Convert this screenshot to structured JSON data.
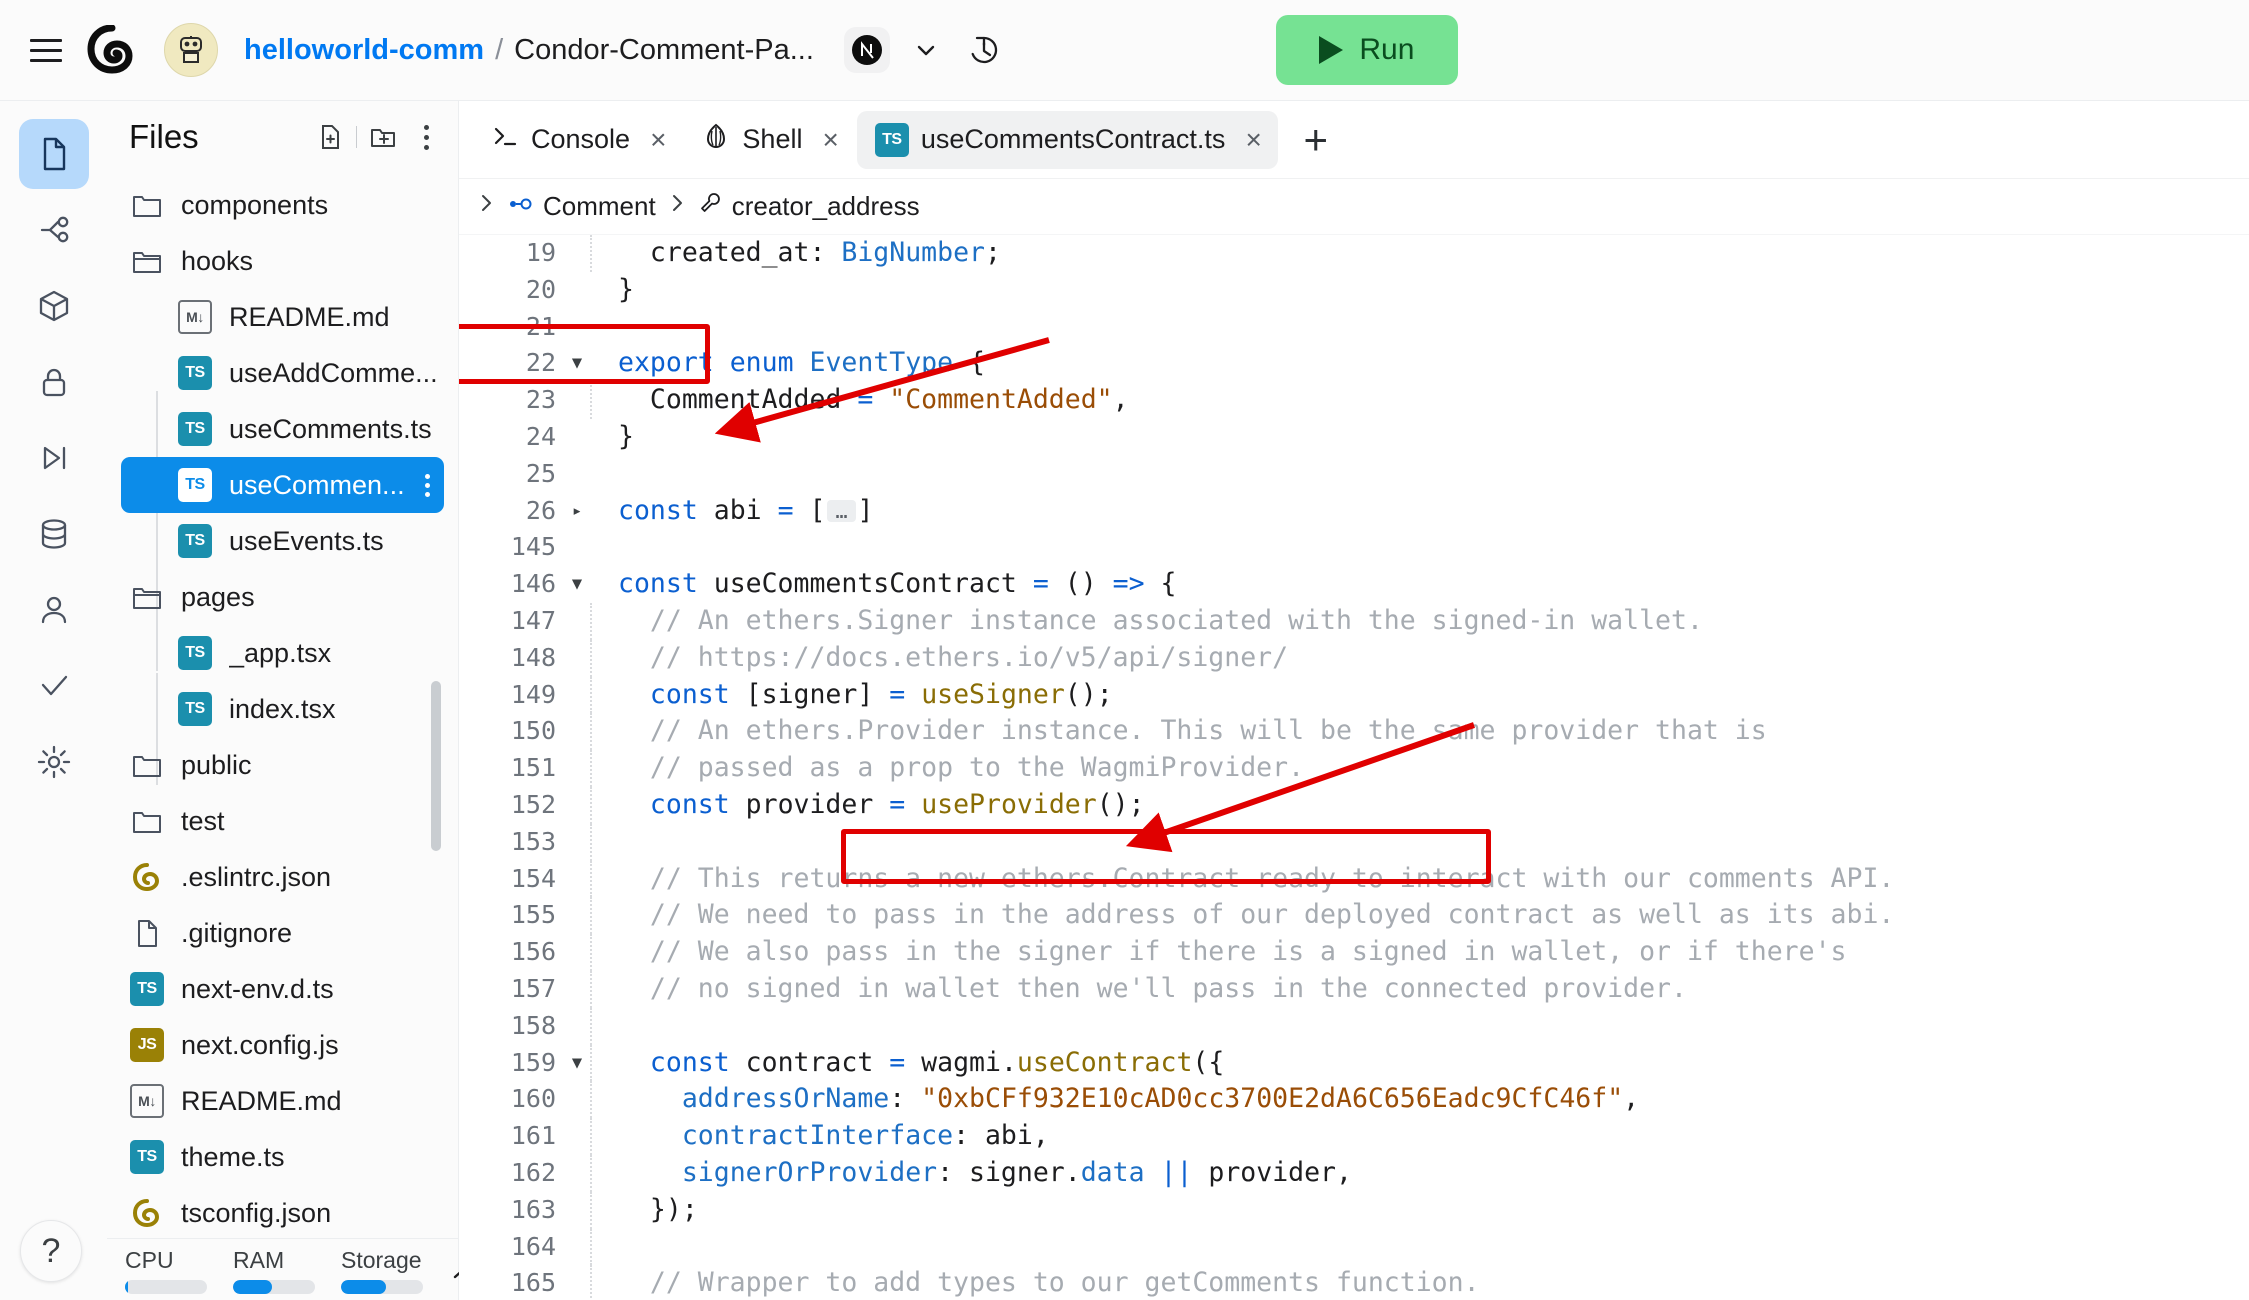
{
  "header": {
    "menu_icon": "hamburger-icon",
    "logo_icon": "replit-logo-icon",
    "avatar_icon": "robot-avatar-icon",
    "owner": "helloworld-comm",
    "separator": "/",
    "repl_name": "Condor-Comment-Pa...",
    "framework_badge": "nextjs-icon",
    "chevron_icon": "chevron-down-icon",
    "history_icon": "history-clock-icon",
    "run_label": "Run",
    "run_color": "#76e293"
  },
  "rail": {
    "items": [
      {
        "name": "files-icon",
        "active": true
      },
      {
        "name": "version-control-icon",
        "active": false
      },
      {
        "name": "packages-icon",
        "active": false
      },
      {
        "name": "secrets-lock-icon",
        "active": false
      },
      {
        "name": "deployments-icon",
        "active": false
      },
      {
        "name": "database-icon",
        "active": false
      },
      {
        "name": "authentication-user-icon",
        "active": false
      },
      {
        "name": "checks-icon",
        "active": false
      },
      {
        "name": "settings-gear-icon",
        "active": false
      }
    ],
    "help_label": "?"
  },
  "files": {
    "title": "Files",
    "new_file_icon": "new-file-icon",
    "new_folder_icon": "new-folder-icon",
    "more_icon": "more-vertical-icon",
    "tree": [
      {
        "label": "components",
        "type": "folder",
        "depth": 1,
        "open": false
      },
      {
        "label": "hooks",
        "type": "folder-open",
        "depth": 1,
        "open": true
      },
      {
        "label": "README.md",
        "type": "md",
        "depth": 2
      },
      {
        "label": "useAddComme...",
        "type": "ts",
        "depth": 2
      },
      {
        "label": "useComments.ts",
        "type": "ts",
        "depth": 2
      },
      {
        "label": "useCommen...",
        "type": "ts",
        "depth": 2,
        "selected": true
      },
      {
        "label": "useEvents.ts",
        "type": "ts",
        "depth": 2
      },
      {
        "label": "pages",
        "type": "folder-open",
        "depth": 1,
        "open": true
      },
      {
        "label": "_app.tsx",
        "type": "ts",
        "depth": 2
      },
      {
        "label": "index.tsx",
        "type": "ts",
        "depth": 2
      },
      {
        "label": "public",
        "type": "folder",
        "depth": 1
      },
      {
        "label": "test",
        "type": "folder",
        "depth": 1
      },
      {
        "label": ".eslintrc.json",
        "type": "replit",
        "depth": 1
      },
      {
        "label": ".gitignore",
        "type": "file",
        "depth": 1
      },
      {
        "label": "next-env.d.ts",
        "type": "ts",
        "depth": 1
      },
      {
        "label": "next.config.js",
        "type": "js",
        "depth": 1
      },
      {
        "label": "README.md",
        "type": "md",
        "depth": 1
      },
      {
        "label": "theme.ts",
        "type": "ts",
        "depth": 1
      },
      {
        "label": "tsconfig.json",
        "type": "replit",
        "depth": 1
      }
    ],
    "resources": [
      {
        "label": "CPU",
        "percent": 4
      },
      {
        "label": "RAM",
        "percent": 48
      },
      {
        "label": "Storage",
        "percent": 55
      }
    ],
    "collapse_icon": "chevron-up-icon"
  },
  "editor": {
    "tabs": [
      {
        "label": "Console",
        "icon": "console-prompt-icon",
        "active": false,
        "close": "×"
      },
      {
        "label": "Shell",
        "icon": "shell-icon",
        "active": false,
        "close": "×"
      },
      {
        "label": "useCommentsContract.ts",
        "icon": "ts-file-icon",
        "active": true,
        "close": "×"
      }
    ],
    "add_tab_label": "+",
    "breadcrumb": {
      "expand_icon": "chevron-right-icon",
      "items": [
        {
          "label": "Comment",
          "icon": "interface-icon"
        },
        {
          "label": "creator_address",
          "icon": "property-wrench-icon"
        }
      ],
      "separator": "›"
    },
    "code_lines": [
      {
        "no": "19",
        "fold": "",
        "indent": true,
        "tokens": [
          {
            "t": "  ",
            "c": "plain"
          },
          {
            "t": "created_at",
            "c": "plain"
          },
          {
            "t": ": ",
            "c": "plain"
          },
          {
            "t": "BigNumber",
            "c": "prop"
          },
          {
            "t": ";",
            "c": "plain"
          }
        ]
      },
      {
        "no": "20",
        "fold": "",
        "indent": false,
        "tokens": [
          {
            "t": "}",
            "c": "plain"
          }
        ]
      },
      {
        "no": "21",
        "fold": "",
        "indent": false,
        "tokens": []
      },
      {
        "no": "22",
        "fold": "▼",
        "indent": false,
        "tokens": [
          {
            "t": "export",
            "c": "kw"
          },
          {
            "t": " ",
            "c": "plain"
          },
          {
            "t": "enum",
            "c": "kw"
          },
          {
            "t": " ",
            "c": "plain"
          },
          {
            "t": "EventType",
            "c": "prop"
          },
          {
            "t": " {",
            "c": "plain"
          }
        ]
      },
      {
        "no": "23",
        "fold": "",
        "indent": true,
        "tokens": [
          {
            "t": "  CommentAdded ",
            "c": "plain"
          },
          {
            "t": "=",
            "c": "kw"
          },
          {
            "t": " ",
            "c": "plain"
          },
          {
            "t": "\"CommentAdded\"",
            "c": "str"
          },
          {
            "t": ",",
            "c": "plain"
          }
        ]
      },
      {
        "no": "24",
        "fold": "",
        "indent": false,
        "tokens": [
          {
            "t": "}",
            "c": "plain"
          }
        ]
      },
      {
        "no": "25",
        "fold": "",
        "indent": false,
        "tokens": []
      },
      {
        "no": "26",
        "fold": "▸",
        "indent": false,
        "highlighted": true,
        "tokens": [
          {
            "t": "const",
            "c": "kw"
          },
          {
            "t": " abi ",
            "c": "plain"
          },
          {
            "t": "=",
            "c": "kw"
          },
          {
            "t": " [",
            "c": "plain"
          },
          {
            "t": "…",
            "c": "ellip"
          },
          {
            "t": "]",
            "c": "plain"
          }
        ]
      },
      {
        "no": "145",
        "fold": "",
        "indent": false,
        "tokens": []
      },
      {
        "no": "146",
        "fold": "▼",
        "indent": false,
        "tokens": [
          {
            "t": "const",
            "c": "kw"
          },
          {
            "t": " useCommentsContract ",
            "c": "plain"
          },
          {
            "t": "=",
            "c": "kw"
          },
          {
            "t": " () ",
            "c": "plain"
          },
          {
            "t": "=>",
            "c": "kw"
          },
          {
            "t": " {",
            "c": "plain"
          }
        ]
      },
      {
        "no": "147",
        "fold": "",
        "indent": true,
        "tokens": [
          {
            "t": "  // An ethers.Signer instance associated with the signed-in wallet.",
            "c": "cmt"
          }
        ]
      },
      {
        "no": "148",
        "fold": "",
        "indent": true,
        "tokens": [
          {
            "t": "  // https://docs.ethers.io/v5/api/signer/",
            "c": "cmt"
          }
        ]
      },
      {
        "no": "149",
        "fold": "",
        "indent": true,
        "tokens": [
          {
            "t": "  ",
            "c": "plain"
          },
          {
            "t": "const",
            "c": "kw"
          },
          {
            "t": " [signer] ",
            "c": "plain"
          },
          {
            "t": "=",
            "c": "kw"
          },
          {
            "t": " ",
            "c": "plain"
          },
          {
            "t": "useSigner",
            "c": "fn"
          },
          {
            "t": "();",
            "c": "plain"
          }
        ]
      },
      {
        "no": "150",
        "fold": "",
        "indent": true,
        "tokens": [
          {
            "t": "  // An ethers.Provider instance. This will be the same provider that is",
            "c": "cmt"
          }
        ]
      },
      {
        "no": "151",
        "fold": "",
        "indent": true,
        "tokens": [
          {
            "t": "  // passed as a prop to the WagmiProvider.",
            "c": "cmt"
          }
        ]
      },
      {
        "no": "152",
        "fold": "",
        "indent": true,
        "tokens": [
          {
            "t": "  ",
            "c": "plain"
          },
          {
            "t": "const",
            "c": "kw"
          },
          {
            "t": " provider ",
            "c": "plain"
          },
          {
            "t": "=",
            "c": "kw"
          },
          {
            "t": " ",
            "c": "plain"
          },
          {
            "t": "useProvider",
            "c": "fn"
          },
          {
            "t": "();",
            "c": "plain"
          }
        ]
      },
      {
        "no": "153",
        "fold": "",
        "indent": true,
        "tokens": []
      },
      {
        "no": "154",
        "fold": "",
        "indent": true,
        "tokens": [
          {
            "t": "  // This returns a new ethers.Contract ready to interact with our comments API.",
            "c": "cmt"
          }
        ]
      },
      {
        "no": "155",
        "fold": "",
        "indent": true,
        "tokens": [
          {
            "t": "  // We need to pass in the address of our deployed contract as well as its abi.",
            "c": "cmt"
          }
        ]
      },
      {
        "no": "156",
        "fold": "",
        "indent": true,
        "tokens": [
          {
            "t": "  // We also pass in the signer if there is a signed in wallet, or if there's",
            "c": "cmt"
          }
        ]
      },
      {
        "no": "157",
        "fold": "",
        "indent": true,
        "tokens": [
          {
            "t": "  // no signed in wallet then we'll pass in the connected provider.",
            "c": "cmt"
          }
        ]
      },
      {
        "no": "158",
        "fold": "",
        "indent": true,
        "tokens": []
      },
      {
        "no": "159",
        "fold": "▼",
        "indent": true,
        "tokens": [
          {
            "t": "  ",
            "c": "plain"
          },
          {
            "t": "const",
            "c": "kw"
          },
          {
            "t": " contract ",
            "c": "plain"
          },
          {
            "t": "=",
            "c": "kw"
          },
          {
            "t": " wagmi.",
            "c": "plain"
          },
          {
            "t": "useContract",
            "c": "fn"
          },
          {
            "t": "({",
            "c": "plain"
          }
        ]
      },
      {
        "no": "160",
        "fold": "",
        "indent": true,
        "tokens": [
          {
            "t": "    ",
            "c": "plain"
          },
          {
            "t": "addressOrName",
            "c": "prop"
          },
          {
            "t": ": ",
            "c": "plain"
          },
          {
            "t": "\"0xbCFf932E10cAD0cc3700E2dA6C656Eadc9CfC46f\"",
            "c": "str"
          },
          {
            "t": ",",
            "c": "plain"
          }
        ]
      },
      {
        "no": "161",
        "fold": "",
        "indent": true,
        "tokens": [
          {
            "t": "    ",
            "c": "plain"
          },
          {
            "t": "contractInterface",
            "c": "prop"
          },
          {
            "t": ": abi,",
            "c": "plain"
          }
        ]
      },
      {
        "no": "162",
        "fold": "",
        "indent": true,
        "tokens": [
          {
            "t": "    ",
            "c": "plain"
          },
          {
            "t": "signerOrProvider",
            "c": "prop"
          },
          {
            "t": ": signer.",
            "c": "plain"
          },
          {
            "t": "data",
            "c": "prop"
          },
          {
            "t": " ",
            "c": "plain"
          },
          {
            "t": "||",
            "c": "kw"
          },
          {
            "t": " provider,",
            "c": "plain"
          }
        ]
      },
      {
        "no": "163",
        "fold": "",
        "indent": true,
        "tokens": [
          {
            "t": "  });",
            "c": "plain"
          }
        ]
      },
      {
        "no": "164",
        "fold": "",
        "indent": true,
        "tokens": []
      },
      {
        "no": "165",
        "fold": "",
        "indent": true,
        "tokens": [
          {
            "t": "  // Wrapper to add types to our getComments function.",
            "c": "cmt"
          }
        ]
      }
    ]
  },
  "annotations": {
    "highlight_color": "#e00000",
    "boxes": [
      {
        "name": "abi-line-highlight",
        "label": "const abi = [ … ]"
      },
      {
        "name": "contract-address-highlight",
        "label": "\"0xbCFf932E10cAD0cc3700E2dA6C656Eadc9CfC46f\""
      }
    ],
    "arrows": [
      {
        "name": "arrow-to-abi-line"
      },
      {
        "name": "arrow-to-contract-address"
      }
    ]
  }
}
